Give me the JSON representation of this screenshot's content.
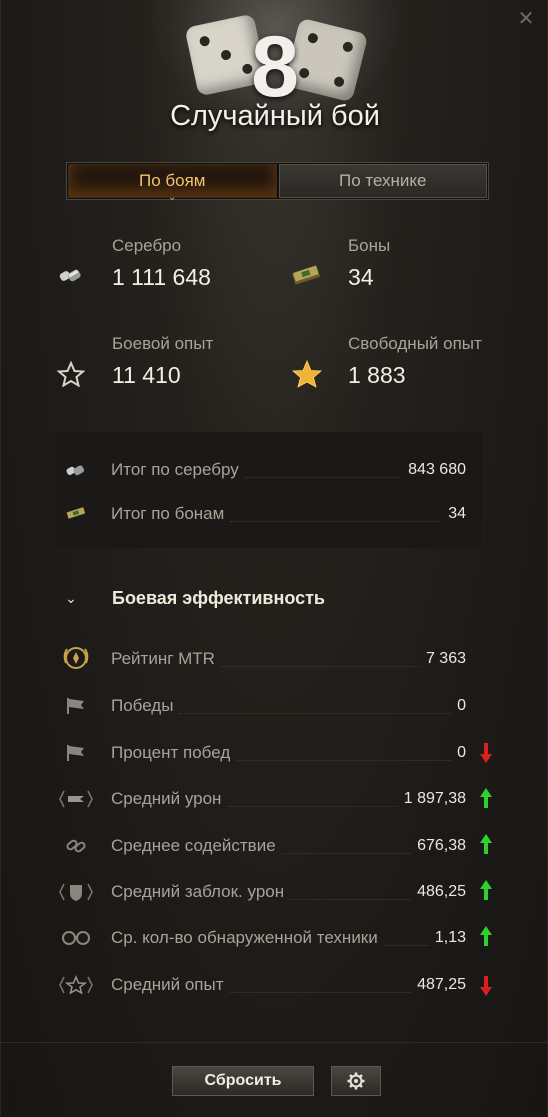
{
  "header": {
    "level": "8",
    "title": "Случайный бой",
    "close_glyph": "✕"
  },
  "tabs": [
    {
      "label": "По боям",
      "active": true
    },
    {
      "label": "По технике",
      "active": false
    }
  ],
  "stats": {
    "silver": {
      "label": "Серебро",
      "value": "1 111 648",
      "icon": "silver-coins-icon"
    },
    "bonds": {
      "label": "Боны",
      "value": "34",
      "icon": "bonds-icon"
    },
    "combat_xp": {
      "label": "Боевой опыт",
      "value": "11 410",
      "icon": "star-outline-icon"
    },
    "free_xp": {
      "label": "Свободный опыт",
      "value": "1 883",
      "icon": "gold-star-icon"
    }
  },
  "totals": [
    {
      "label": "Итог по серебру",
      "value": "843 680",
      "icon": "silver-coins-icon"
    },
    {
      "label": "Итог по бонам",
      "value": "34",
      "icon": "bonds-icon"
    }
  ],
  "efficiency": {
    "title": "Боевая эффективность",
    "rows": [
      {
        "label": "Рейтинг MTR",
        "value": "7 363",
        "icon": "mtr-rating-icon",
        "trend": "none"
      },
      {
        "label": "Победы",
        "value": "0",
        "icon": "flag-icon",
        "trend": "none"
      },
      {
        "label": "Процент побед",
        "value": "0",
        "icon": "flag-icon",
        "trend": "down"
      },
      {
        "label": "Средний урон",
        "value": "1 897,38",
        "icon": "damage-icon",
        "trend": "up"
      },
      {
        "label": "Среднее содействие",
        "value": "676,38",
        "icon": "assist-icon",
        "trend": "up"
      },
      {
        "label": "Средний заблок. урон",
        "value": "486,25",
        "icon": "blocked-damage-icon",
        "trend": "up"
      },
      {
        "label": "Ср. кол-во обнаруженной техники",
        "value": "1,13",
        "icon": "spotted-icon",
        "trend": "up"
      },
      {
        "label": "Средний опыт",
        "value": "487,25",
        "icon": "avg-xp-icon",
        "trend": "down"
      }
    ]
  },
  "footer": {
    "reset_label": "Сбросить",
    "settings_icon": "gear-icon"
  },
  "colors": {
    "up": "#2fd12f",
    "down": "#d92020",
    "active_tab": "#f5c26b"
  }
}
